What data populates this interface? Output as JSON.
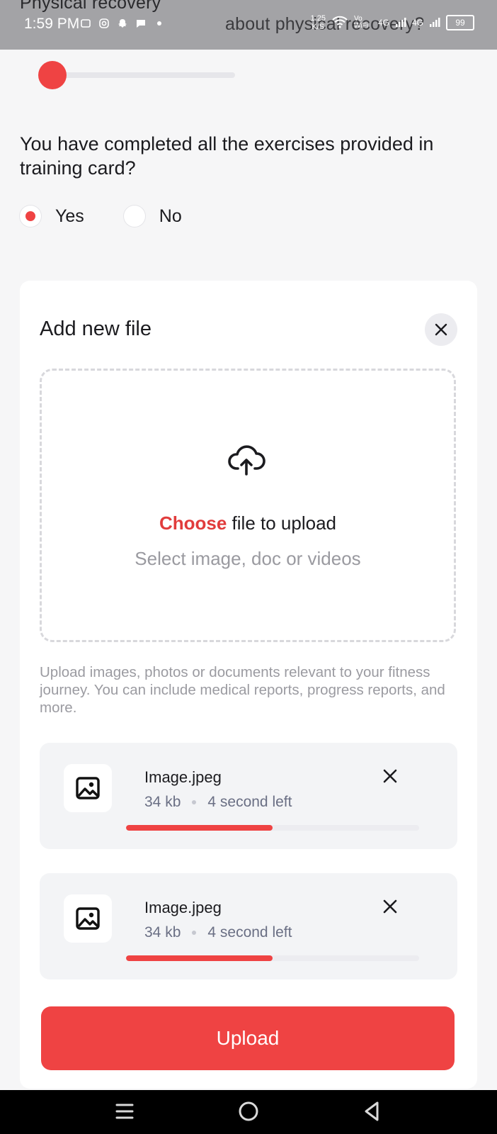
{
  "status_bar": {
    "time": "1:59 PM",
    "behind_title": "Physical recovery",
    "behind_question": "about physical recovery?",
    "net_speed_value": "1.25",
    "net_speed_unit": "K/S",
    "wifi_label": "Vo WiFi",
    "network_1": "4G",
    "network_2": "4G",
    "battery": "99"
  },
  "form": {
    "slider_level": 0.0,
    "question": "You have completed all the exercises provided in training card?",
    "options": [
      {
        "label": "Yes",
        "selected": true
      },
      {
        "label": "No",
        "selected": false
      }
    ]
  },
  "upload_card": {
    "title": "Add new file",
    "dropzone": {
      "accent": "Choose",
      "rest": " file to upload",
      "subtitle": "Select image, doc or videos"
    },
    "help_text": "Upload images, photos or documents relevant to your fitness journey. You can include medical reports, progress reports, and more.",
    "files": [
      {
        "name": "Image.jpeg",
        "size": "34 kb",
        "time_left": "4 second left",
        "progress": 0.5
      },
      {
        "name": "Image.jpeg",
        "size": "34 kb",
        "time_left": "4 second left",
        "progress": 0.5
      }
    ],
    "upload_label": "Upload"
  },
  "colors": {
    "accent": "#ef4343",
    "background": "#f6f6f7",
    "card": "#ffffff"
  },
  "icons": {
    "close": "close-icon",
    "upload": "cloud-upload-icon",
    "file_thumb": "image-icon",
    "nav": [
      "recent-apps-icon",
      "home-icon",
      "back-icon"
    ]
  }
}
